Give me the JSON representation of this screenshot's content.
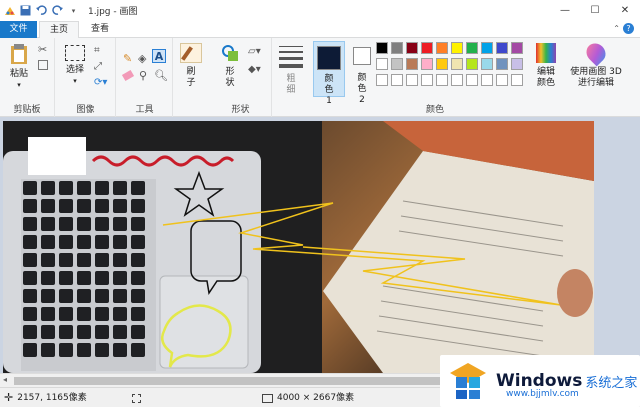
{
  "app": {
    "title": "1.jpg - 画图"
  },
  "tabs": [
    {
      "label": "文件"
    },
    {
      "label": "主页"
    },
    {
      "label": "查看"
    }
  ],
  "ribbon": {
    "clipboard": {
      "paste": "粘贴",
      "label": "剪贴板"
    },
    "image": {
      "select": "选择",
      "label": "图像"
    },
    "tools": {
      "label": "工具"
    },
    "brushes": {
      "label": "刷子"
    },
    "shapes": {
      "label": "形状"
    },
    "size": {
      "label": "粗细"
    },
    "color1": {
      "label": "颜色 1"
    },
    "color2": {
      "label": "颜色 2"
    },
    "colors": {
      "label": "颜色"
    },
    "edit_colors": {
      "label": "编辑颜色"
    },
    "paint3d": {
      "label": "使用画图 3D 进行编辑"
    }
  },
  "palette": {
    "row1": [
      "#000000",
      "#7f7f7f",
      "#880015",
      "#ed1c24",
      "#ff7f27",
      "#fff200",
      "#22b14c",
      "#00a2e8",
      "#3f48cc",
      "#a349a4"
    ],
    "row2": [
      "#ffffff",
      "#c3c3c3",
      "#b97a57",
      "#ffaec9",
      "#ffc90e",
      "#efe4b0",
      "#b5e61d",
      "#99d9ea",
      "#7092be",
      "#c8bfe7"
    ],
    "row3": [
      "#ffffff",
      "#ffffff",
      "#ffffff",
      "#ffffff",
      "#ffffff",
      "#ffffff",
      "#ffffff",
      "#ffffff",
      "#ffffff",
      "#ffffff"
    ],
    "color1": "#0d1b36",
    "color2": "#ffffff"
  },
  "status": {
    "cursor_pos": "2157, 1165像素",
    "image_size": "4000 × 2667像素"
  },
  "watermark": {
    "brand": "Windows",
    "suffix": "系统之家",
    "url": "www.bjjmlv.com"
  }
}
